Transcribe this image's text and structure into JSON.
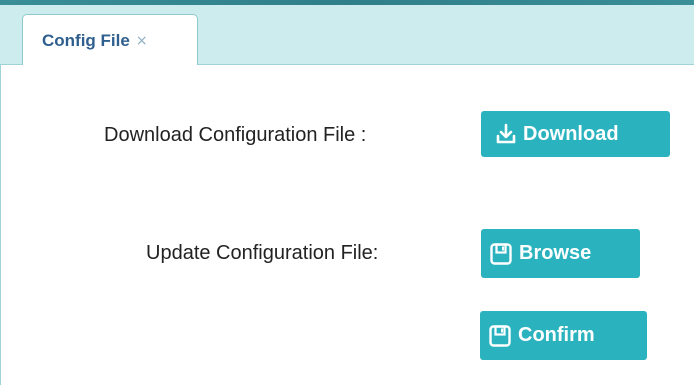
{
  "tabs": [
    {
      "label": "Config File",
      "close_glyph": "×"
    }
  ],
  "download_row": {
    "label": "Download Configuration File :",
    "button_label": "Download",
    "button_icon": "download-icon"
  },
  "update_row": {
    "label": "Update Configuration File:",
    "browse_label": "Browse",
    "browse_icon": "floppy-disk-icon",
    "confirm_label": "Confirm",
    "confirm_icon": "floppy-disk-icon"
  },
  "colors": {
    "accent": "#2ab3bf",
    "tab_bar": "#cdeced",
    "tab_text": "#2e5f8f",
    "top_strip": "#2f7f8a"
  }
}
